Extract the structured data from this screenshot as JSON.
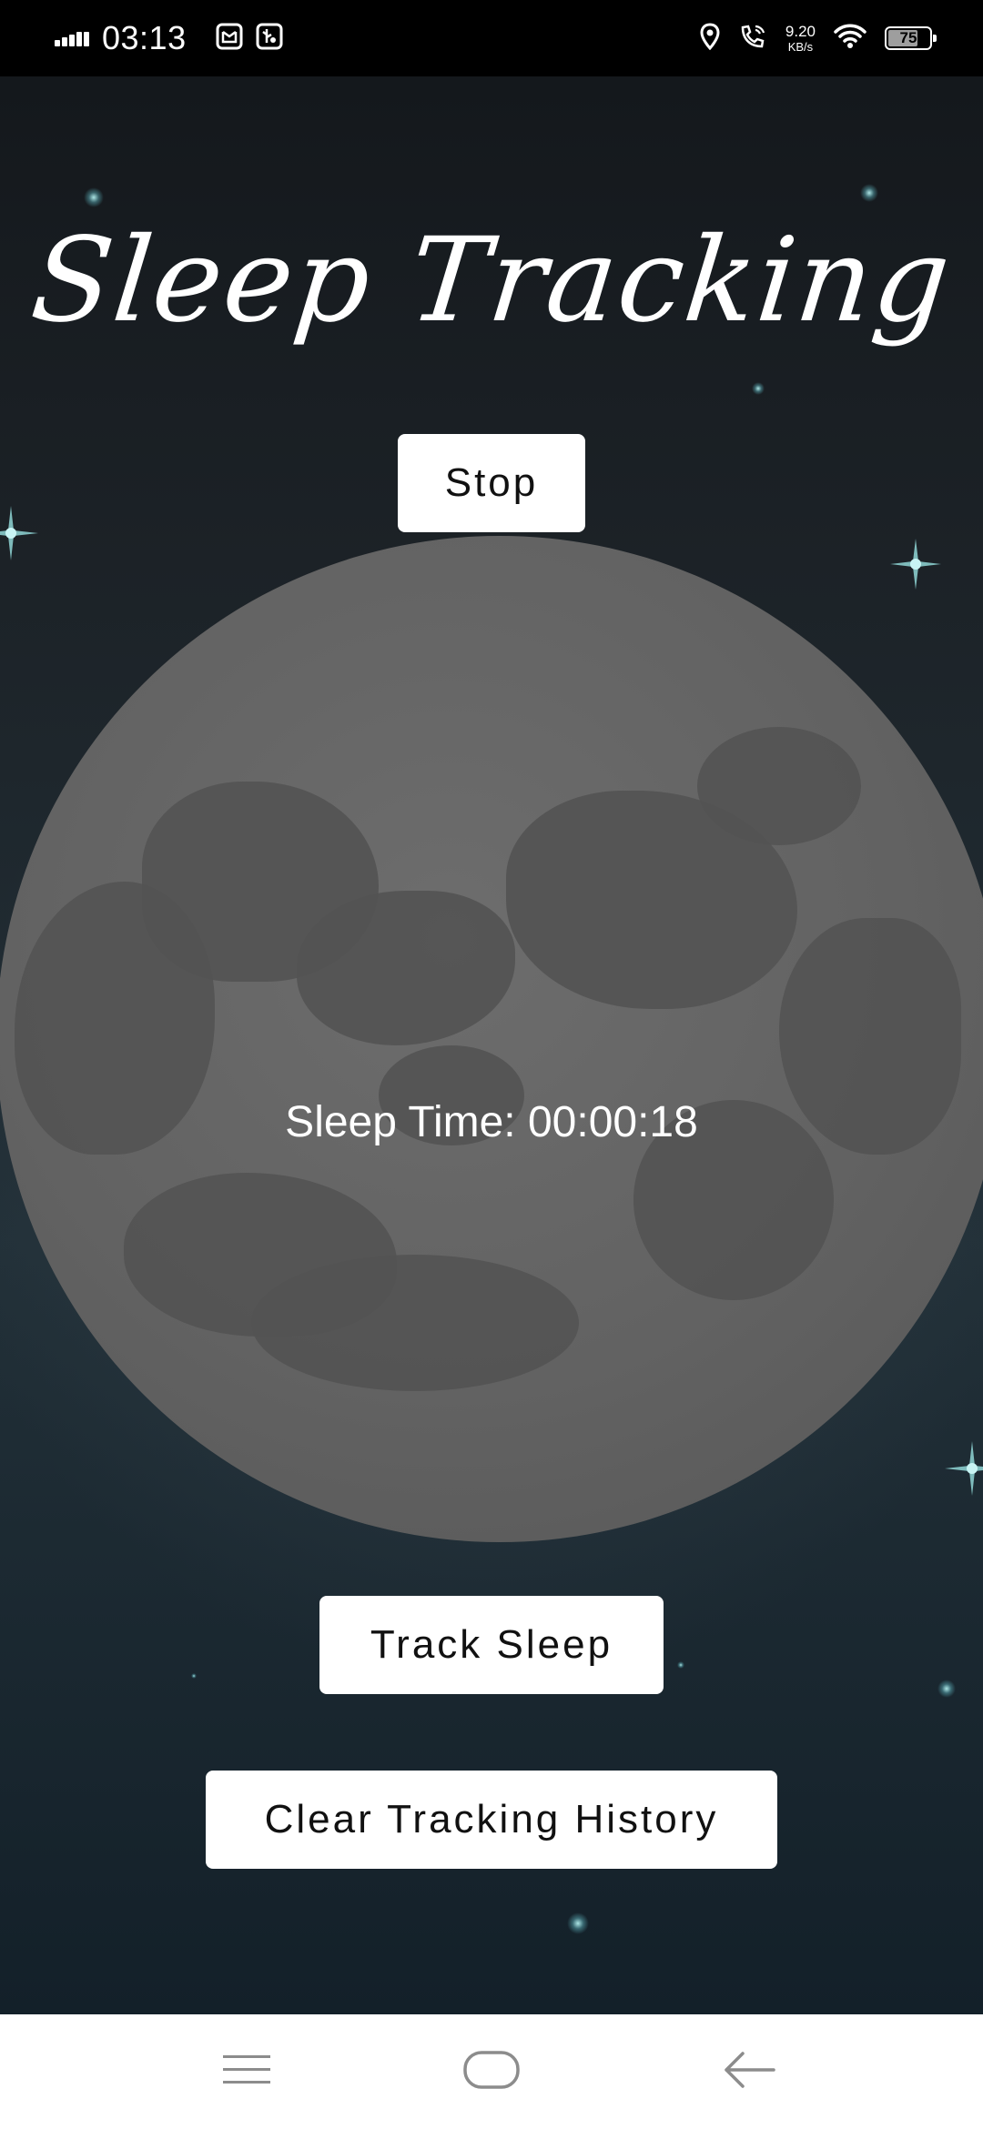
{
  "status_bar": {
    "time": "03:13",
    "speed_value": "9.20",
    "speed_unit": "KB/s",
    "battery": "75",
    "battery_fraction": 0.75,
    "icons": [
      "signal-icon",
      "mail-icon",
      "usb-icon",
      "location-icon",
      "wifi-calling-icon",
      "wifi-icon",
      "battery-icon"
    ]
  },
  "app": {
    "title": "Sleep Tracking",
    "stop_button": "Stop",
    "sleep_time": "Sleep Time: 00:00:18",
    "track_button": "Track Sleep",
    "clear_button": "Clear Tracking History"
  },
  "nav_bar": {
    "icons": [
      "menu-icon",
      "home-icon",
      "back-icon"
    ]
  },
  "colors": {
    "background_top": "#14181c",
    "background_bottom": "#132029",
    "moon": "#626262",
    "button_bg": "#ffffff",
    "button_text": "#111111"
  }
}
